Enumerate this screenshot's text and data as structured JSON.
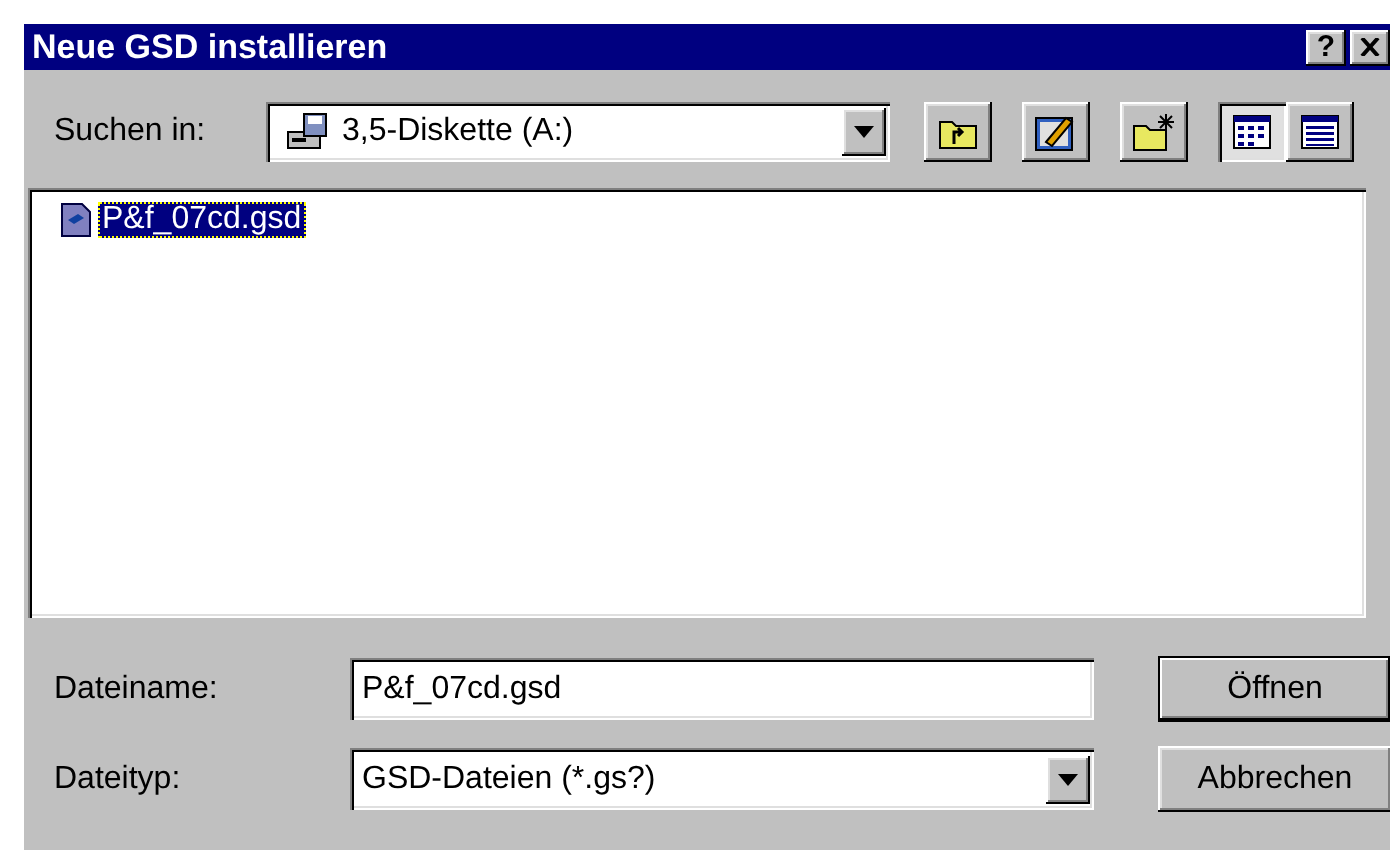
{
  "window": {
    "title": "Neue GSD installieren",
    "help": "?"
  },
  "look_in": {
    "label": "Suchen in:",
    "value": "3,5-Diskette (A:)"
  },
  "toolbar": [
    {
      "kind": "up",
      "selected": false
    },
    {
      "kind": "desktop",
      "selected": false
    },
    {
      "kind": "new_folder",
      "selected": false
    },
    {
      "kind": "list",
      "selected": true
    },
    {
      "kind": "details",
      "selected": false
    }
  ],
  "files": [
    {
      "name": "P&f_07cd.gsd",
      "selected": true
    }
  ],
  "file_name": {
    "label": "Dateiname:",
    "value": "P&f_07cd.gsd"
  },
  "file_type": {
    "label": "Dateityp:",
    "value": "GSD-Dateien (*.gs?)"
  },
  "buttons": [
    {
      "label": "Öffnen",
      "default": true
    },
    {
      "label": "Abbrechen",
      "default": false
    }
  ]
}
